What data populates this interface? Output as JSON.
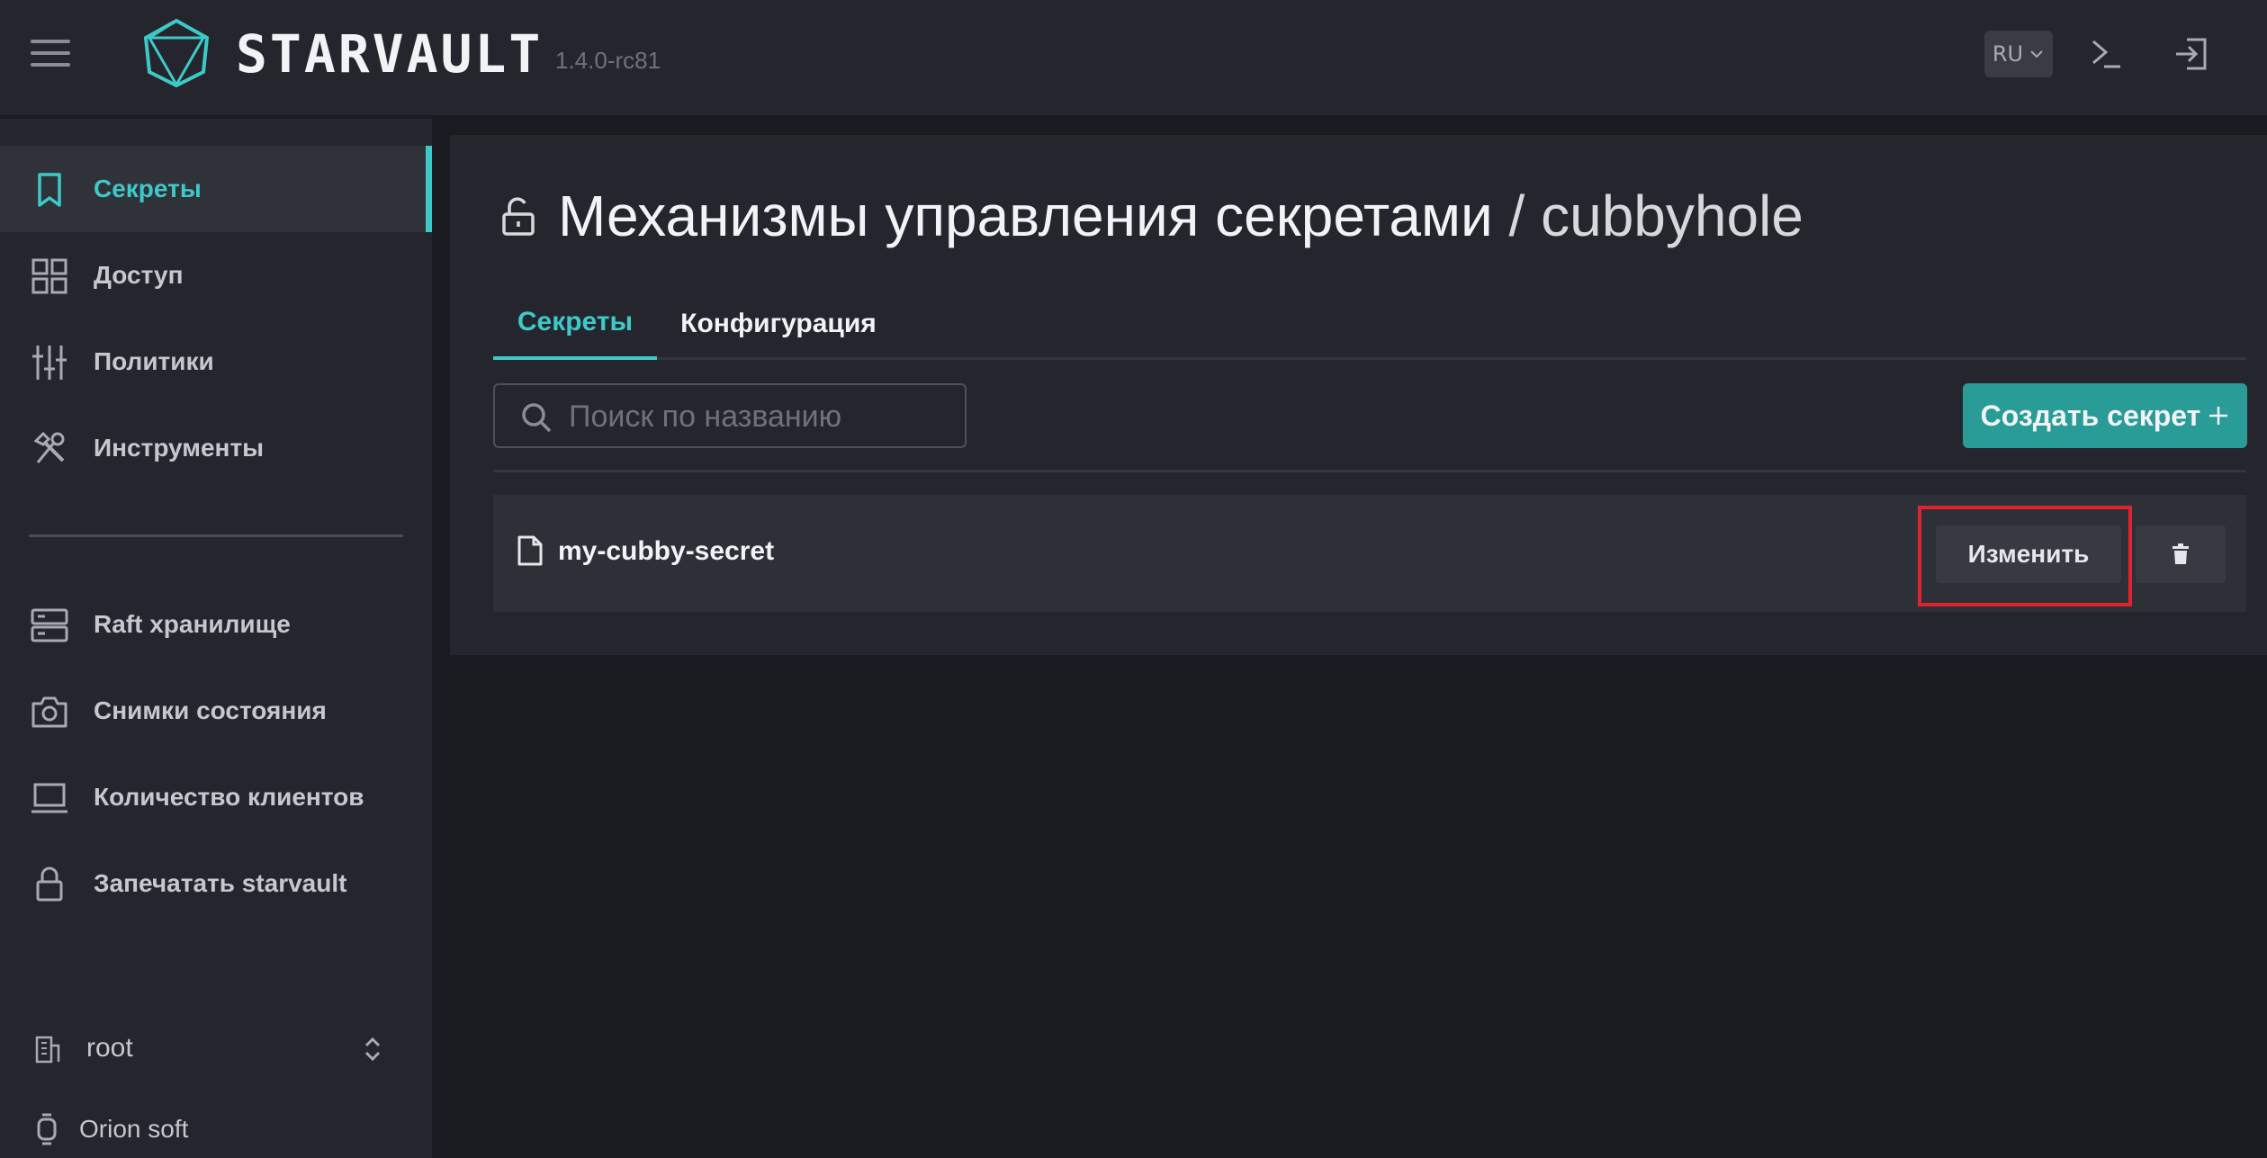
{
  "header": {
    "brand": "STARVAULT",
    "version": "1.4.0-rc81",
    "language": "RU",
    "menu_icon": "hamburger-menu-icon",
    "console_icon": "terminal-icon",
    "logout_icon": "sign-out-icon"
  },
  "sidebar": {
    "items": [
      {
        "label": "Секреты",
        "icon": "bookmark-icon",
        "active": true
      },
      {
        "label": "Доступ",
        "icon": "grid-icon"
      },
      {
        "label": "Политики",
        "icon": "sliders-icon"
      },
      {
        "label": "Инструменты",
        "icon": "tools-icon"
      }
    ],
    "items2": [
      {
        "label": "Raft хранилище",
        "icon": "server-icon"
      },
      {
        "label": "Снимки состояния",
        "icon": "camera-icon"
      },
      {
        "label": "Количество клиентов",
        "icon": "laptop-icon"
      },
      {
        "label": "Запечатать starvault",
        "icon": "lock-icon"
      }
    ],
    "namespace": "root",
    "organization": "Orion soft"
  },
  "main": {
    "title_prefix": "Механизмы управления секретами",
    "title_sep": " / ",
    "title_current": "cubbyhole",
    "tabs": [
      {
        "label": "Секреты",
        "active": true
      },
      {
        "label": "Конфигурация",
        "active": false
      }
    ],
    "search_placeholder": "Поиск по названию",
    "create_button": "Создать секрет",
    "secrets": [
      {
        "name": "my-cubby-secret",
        "edit_label": "Изменить"
      }
    ]
  },
  "colors": {
    "accent": "#3ec9c9",
    "primary_button": "#2a9c98",
    "highlight": "#e0232f"
  }
}
